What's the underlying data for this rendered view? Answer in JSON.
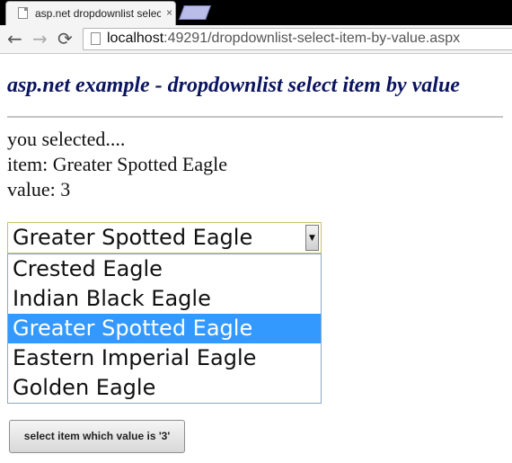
{
  "browser": {
    "tab_title": "asp.net dropdownlist selec",
    "tab_close": "×",
    "back_icon": "←",
    "forward_icon": "→",
    "reload_icon": "⟳",
    "url_host": "localhost",
    "url_rest": ":49291/dropdownlist-select-item-by-value.aspx"
  },
  "page": {
    "heading": "asp.net example - dropdownlist select item by value",
    "result_line1": "you selected....",
    "result_line2": "item: Greater Spotted Eagle",
    "result_line3": "value: 3"
  },
  "dropdown": {
    "selected_value": "Greater Spotted Eagle",
    "arrow_icon": "▼",
    "options": [
      {
        "label": "Crested Eagle"
      },
      {
        "label": "Indian Black Eagle"
      },
      {
        "label": "Greater Spotted Eagle"
      },
      {
        "label": "Eastern Imperial Eagle"
      },
      {
        "label": "Golden Eagle"
      }
    ],
    "highlight_index": 2
  },
  "button": {
    "label": "select item which value is '3'"
  }
}
